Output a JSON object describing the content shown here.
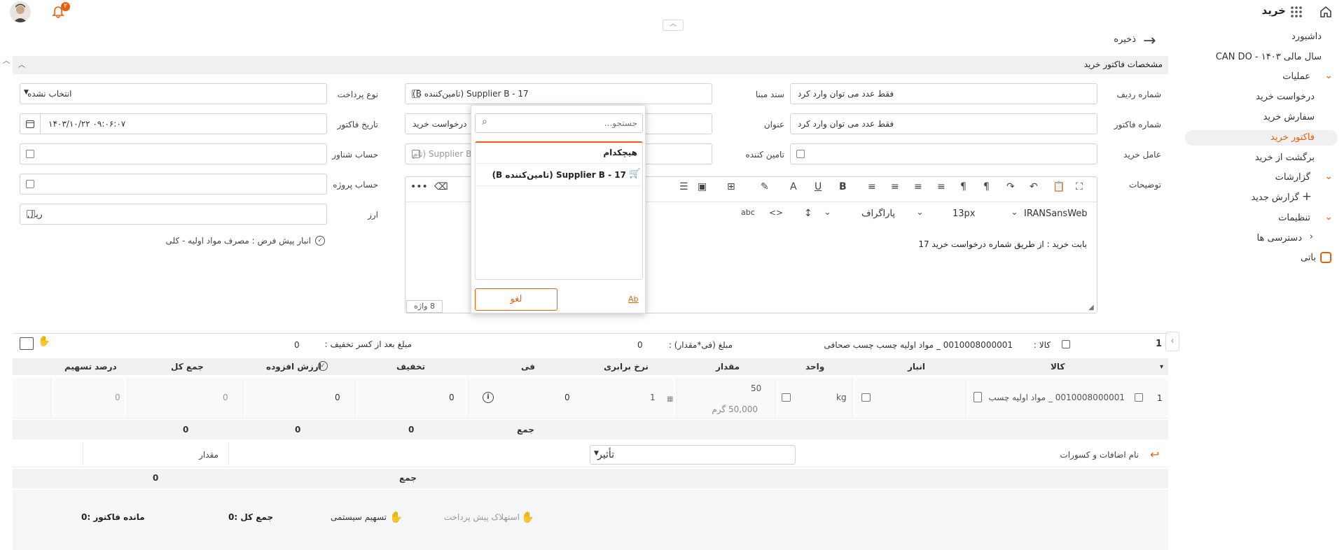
{
  "header": {
    "app_title": "خرید",
    "notification_count": "۲"
  },
  "sidebar": {
    "items": [
      {
        "label": "داشبورد"
      },
      {
        "label": "CAN DO - سال مالی ۱۴۰۳"
      },
      {
        "label": "عملیات"
      },
      {
        "label": "درخواست خرید"
      },
      {
        "label": "سفارش خرید"
      },
      {
        "label": "فاکتور خرید"
      },
      {
        "label": "برگشت از خرید"
      },
      {
        "label": "گزارشات"
      },
      {
        "label": "گزارش جدید"
      },
      {
        "label": "تنظیمات"
      },
      {
        "label": "دسترسی ها"
      },
      {
        "label": "باتی"
      }
    ]
  },
  "toolbar": {
    "save_label": "ذخیره"
  },
  "panel": {
    "title": "مشخصات فاکتور خرید"
  },
  "form": {
    "row_number": {
      "label": "شماره ردیف",
      "placeholder": "فقط عدد می توان وارد کرد"
    },
    "invoice_number": {
      "label": "شماره فاکتور",
      "placeholder": "فقط عدد می توان وارد کرد"
    },
    "buyer_agent": {
      "label": "عامل خرید",
      "value": ""
    },
    "description": {
      "label": "توضیحات"
    },
    "source_doc": {
      "label": "سند مبنا",
      "value": "Supplier B - 17 (تامین‌کننده B)"
    },
    "title_field": {
      "label": "عنوان",
      "value": "درخواست خرید"
    },
    "supplier": {
      "label": "تامین کننده",
      "value": "Supplier B (تام"
    },
    "payment_type": {
      "label": "نوع پرداخت",
      "value": "انتخاب نشده"
    },
    "invoice_date": {
      "label": "تاریخ فاکتور",
      "value": "۱۴۰۳/۱۰/۲۲ ۰۹:۰۶:۰۷"
    },
    "floating_account": {
      "label": "حساب شناور",
      "value": ""
    },
    "project_account": {
      "label": "حساب پروژه",
      "value": ""
    },
    "currency": {
      "label": "ارز",
      "value": "ریال"
    },
    "default_warehouse": "انبار پیش فرض : مصرف مواد اولیه - کلی"
  },
  "editor": {
    "font": "IRANSansWeb",
    "size": "13px",
    "paragraph": "پاراگراف",
    "content": "بابت خرید : از طریق شماره درخواست خرید 17",
    "word_count": "8 واژه"
  },
  "dropdown": {
    "search_placeholder": "جستجو...",
    "options": [
      {
        "label": "هیچکدام"
      },
      {
        "label": "Supplier B - 17 (تامین‌کننده B)"
      }
    ],
    "cancel_label": "لغو",
    "ab_label": "Ab"
  },
  "summary": {
    "row_index": "1",
    "item_label": "کالا :",
    "item_value": "0010008000001 _ مواد اولیه چسب چسب صحافی",
    "amount_label": "مبلغ (فی*مقدار) :",
    "amount_value": "0",
    "after_discount_label": "مبلغ بعد از کسر تخفیف :",
    "after_discount_value": "0"
  },
  "grid": {
    "headers": [
      "کالا",
      "انبار",
      "واحد",
      "مقدار",
      "نرخ برابری",
      "فی",
      "تخفیف",
      "ارزش افزوده",
      "جمع کل",
      "درصد تسهیم"
    ],
    "row": {
      "index": "1",
      "item": "0010008000001 _ مواد اولیه چسب",
      "unit": "kg",
      "qty": "50",
      "qty_sub": "50,000 گرم",
      "rate": "1",
      "price": "0",
      "discount": "0",
      "vat": "0",
      "total": "0",
      "share": "0"
    },
    "sum_label": "جمع",
    "sums": [
      "0",
      "0",
      "0"
    ]
  },
  "additions": {
    "name_label": "نام اضافات و کسورات",
    "effect_label": "تأثیر",
    "amount_label": "مقدار",
    "sum_label": "جمع",
    "sum_value": "0"
  },
  "footer": {
    "prepayment": "استهلاک پیش پرداخت",
    "system_share": "تسهیم سیستمی",
    "total": "جمع کل :0",
    "remaining": "مانده فاکتور :0"
  }
}
